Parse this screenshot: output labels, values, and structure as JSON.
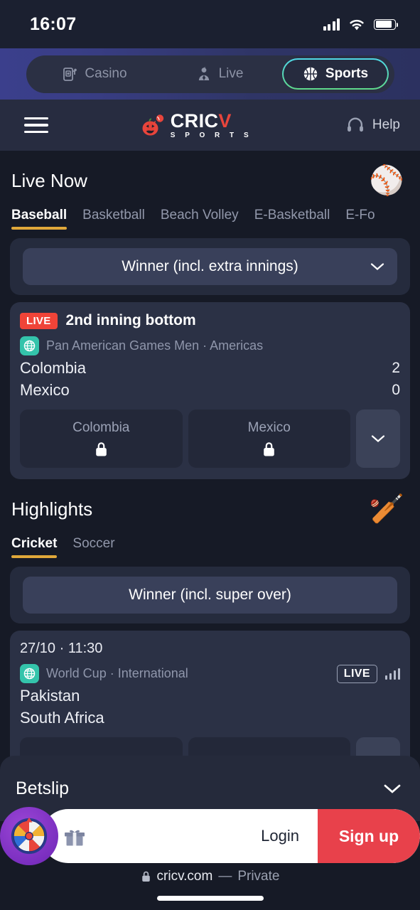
{
  "status_bar": {
    "time": "16:07",
    "signal_icon": "cellular-signal-icon",
    "wifi_icon": "wifi-icon",
    "battery_icon": "battery-icon"
  },
  "top_nav": {
    "items": [
      {
        "label": "Casino",
        "icon": "slot-machine-icon",
        "active": false
      },
      {
        "label": "Live",
        "icon": "live-dealer-icon",
        "active": false
      },
      {
        "label": "Sports",
        "icon": "basketball-icon",
        "active": true
      }
    ],
    "active_border_gradient_from": "#4fd8e8",
    "active_border_gradient_to": "#5fd98a"
  },
  "app_header": {
    "menu_icon": "hamburger-menu-icon",
    "logo": {
      "mark": "pumpkin-cricket-ball-icon",
      "main": "CRIC",
      "accent": "V",
      "sub": "S P O R T S",
      "accent_color": "#e8453c"
    },
    "help_label": "Help",
    "help_icon": "headset-icon"
  },
  "live_now": {
    "title": "Live Now",
    "emoji": "⚾",
    "emoji_name": "baseball-icon",
    "tabs": [
      {
        "label": "Baseball",
        "active": true
      },
      {
        "label": "Basketball",
        "active": false
      },
      {
        "label": "Beach Volley",
        "active": false
      },
      {
        "label": "E-Basketball",
        "active": false
      },
      {
        "label": "E-Fo",
        "active": false
      }
    ],
    "market": "Winner (incl. extra innings)",
    "match": {
      "live_badge": "LIVE",
      "status": "2nd inning bottom",
      "league": "Pan American Games Men · Americas",
      "home_team": "Colombia",
      "home_score": "2",
      "away_team": "Mexico",
      "away_score": "0",
      "odds": [
        {
          "name": "Colombia",
          "locked": true
        },
        {
          "name": "Mexico",
          "locked": true
        }
      ]
    }
  },
  "highlights": {
    "title": "Highlights",
    "emoji": "🏏",
    "emoji_name": "cricket-bat-ball-icon",
    "tabs": [
      {
        "label": "Cricket",
        "active": true
      },
      {
        "label": "Soccer",
        "active": false
      }
    ],
    "market": "Winner (incl. super over)",
    "match": {
      "date": "27/10 · 11:30",
      "league": "World Cup · International",
      "live_badge": "LIVE",
      "home_team": "Pakistan",
      "away_team": "South Africa"
    }
  },
  "betslip": {
    "title": "Betslip",
    "chevron_icon": "chevron-down-icon"
  },
  "auth_bar": {
    "wheel_icon": "fortune-wheel-icon",
    "gift_icon": "gift-icon",
    "login_label": "Login",
    "signup_label": "Sign up",
    "signup_color": "#e8414b"
  },
  "safari": {
    "lock_icon": "lock-icon",
    "url": "cricv.com",
    "dash": "—",
    "mode": "Private"
  },
  "theme": {
    "page_bg": "#161a26",
    "card_bg": "#2b3145",
    "panel_bg": "#252b3d",
    "accent_gold": "#e0a83a",
    "live_red": "#f04438",
    "globe_teal": "#34c4ab"
  }
}
